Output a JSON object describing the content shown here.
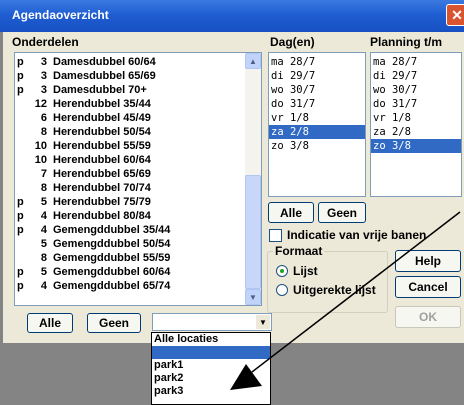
{
  "window": {
    "title": "Agendaoverzicht",
    "close_icon": "✕"
  },
  "onderdelen": {
    "header": "Onderdelen",
    "items": [
      {
        "p": "p",
        "num": "3",
        "name": "Damesdubbel 60/64"
      },
      {
        "p": "p",
        "num": "3",
        "name": "Damesdubbel 65/69"
      },
      {
        "p": "p",
        "num": "3",
        "name": "Damesdubbel 70+"
      },
      {
        "p": "",
        "num": "12",
        "name": "Herendubbel 35/44"
      },
      {
        "p": "",
        "num": "6",
        "name": "Herendubbel 45/49"
      },
      {
        "p": "",
        "num": "8",
        "name": "Herendubbel 50/54"
      },
      {
        "p": "",
        "num": "10",
        "name": "Herendubbel 55/59"
      },
      {
        "p": "",
        "num": "10",
        "name": "Herendubbel 60/64"
      },
      {
        "p": "",
        "num": "7",
        "name": "Herendubbel 65/69"
      },
      {
        "p": "",
        "num": "8",
        "name": "Herendubbel 70/74"
      },
      {
        "p": "p",
        "num": "5",
        "name": "Herendubbel 75/79"
      },
      {
        "p": "p",
        "num": "4",
        "name": "Herendubbel 80/84"
      },
      {
        "p": "p",
        "num": "4",
        "name": "Gemengddubbel 35/44"
      },
      {
        "p": "",
        "num": "5",
        "name": "Gemengddubbel 50/54"
      },
      {
        "p": "",
        "num": "8",
        "name": "Gemengddubbel 55/59"
      },
      {
        "p": "p",
        "num": "5",
        "name": "Gemengddubbel 60/64"
      },
      {
        "p": "p",
        "num": "4",
        "name": "Gemengddubbel 65/74"
      }
    ],
    "alle_label": "Alle",
    "geen_label": "Geen"
  },
  "dagen": {
    "header": "Dag(en)",
    "items": [
      "ma 28/7",
      "di 29/7",
      "wo 30/7",
      "do 31/7",
      "vr 1/8",
      "za 2/8",
      "zo 3/8"
    ],
    "selected_index": 5,
    "alle_label": "Alle",
    "geen_label": "Geen"
  },
  "planning": {
    "header": "Planning t/m",
    "items": [
      "ma 28/7",
      "di 29/7",
      "wo 30/7",
      "do 31/7",
      "vr 1/8",
      "za 2/8",
      "zo 3/8"
    ],
    "selected_index": 6
  },
  "indicatie_label": "Indicatie van vrije banen",
  "formaat": {
    "title": "Formaat",
    "lijst_label": "Lijst",
    "uitgerekte_label": "Uitgerekte lijst",
    "selected": "Lijst"
  },
  "buttons": {
    "help": "Help",
    "cancel": "Cancel",
    "ok": "OK"
  },
  "locaties": {
    "options": [
      "Alle locaties",
      "",
      "park1",
      "park2",
      "park3"
    ],
    "highlighted_index": 1
  },
  "colors": {
    "selection": "#316ac5",
    "title_bar": "#1f5ed2",
    "dialog_bg": "#ece9d8",
    "arrow": "#000000"
  }
}
